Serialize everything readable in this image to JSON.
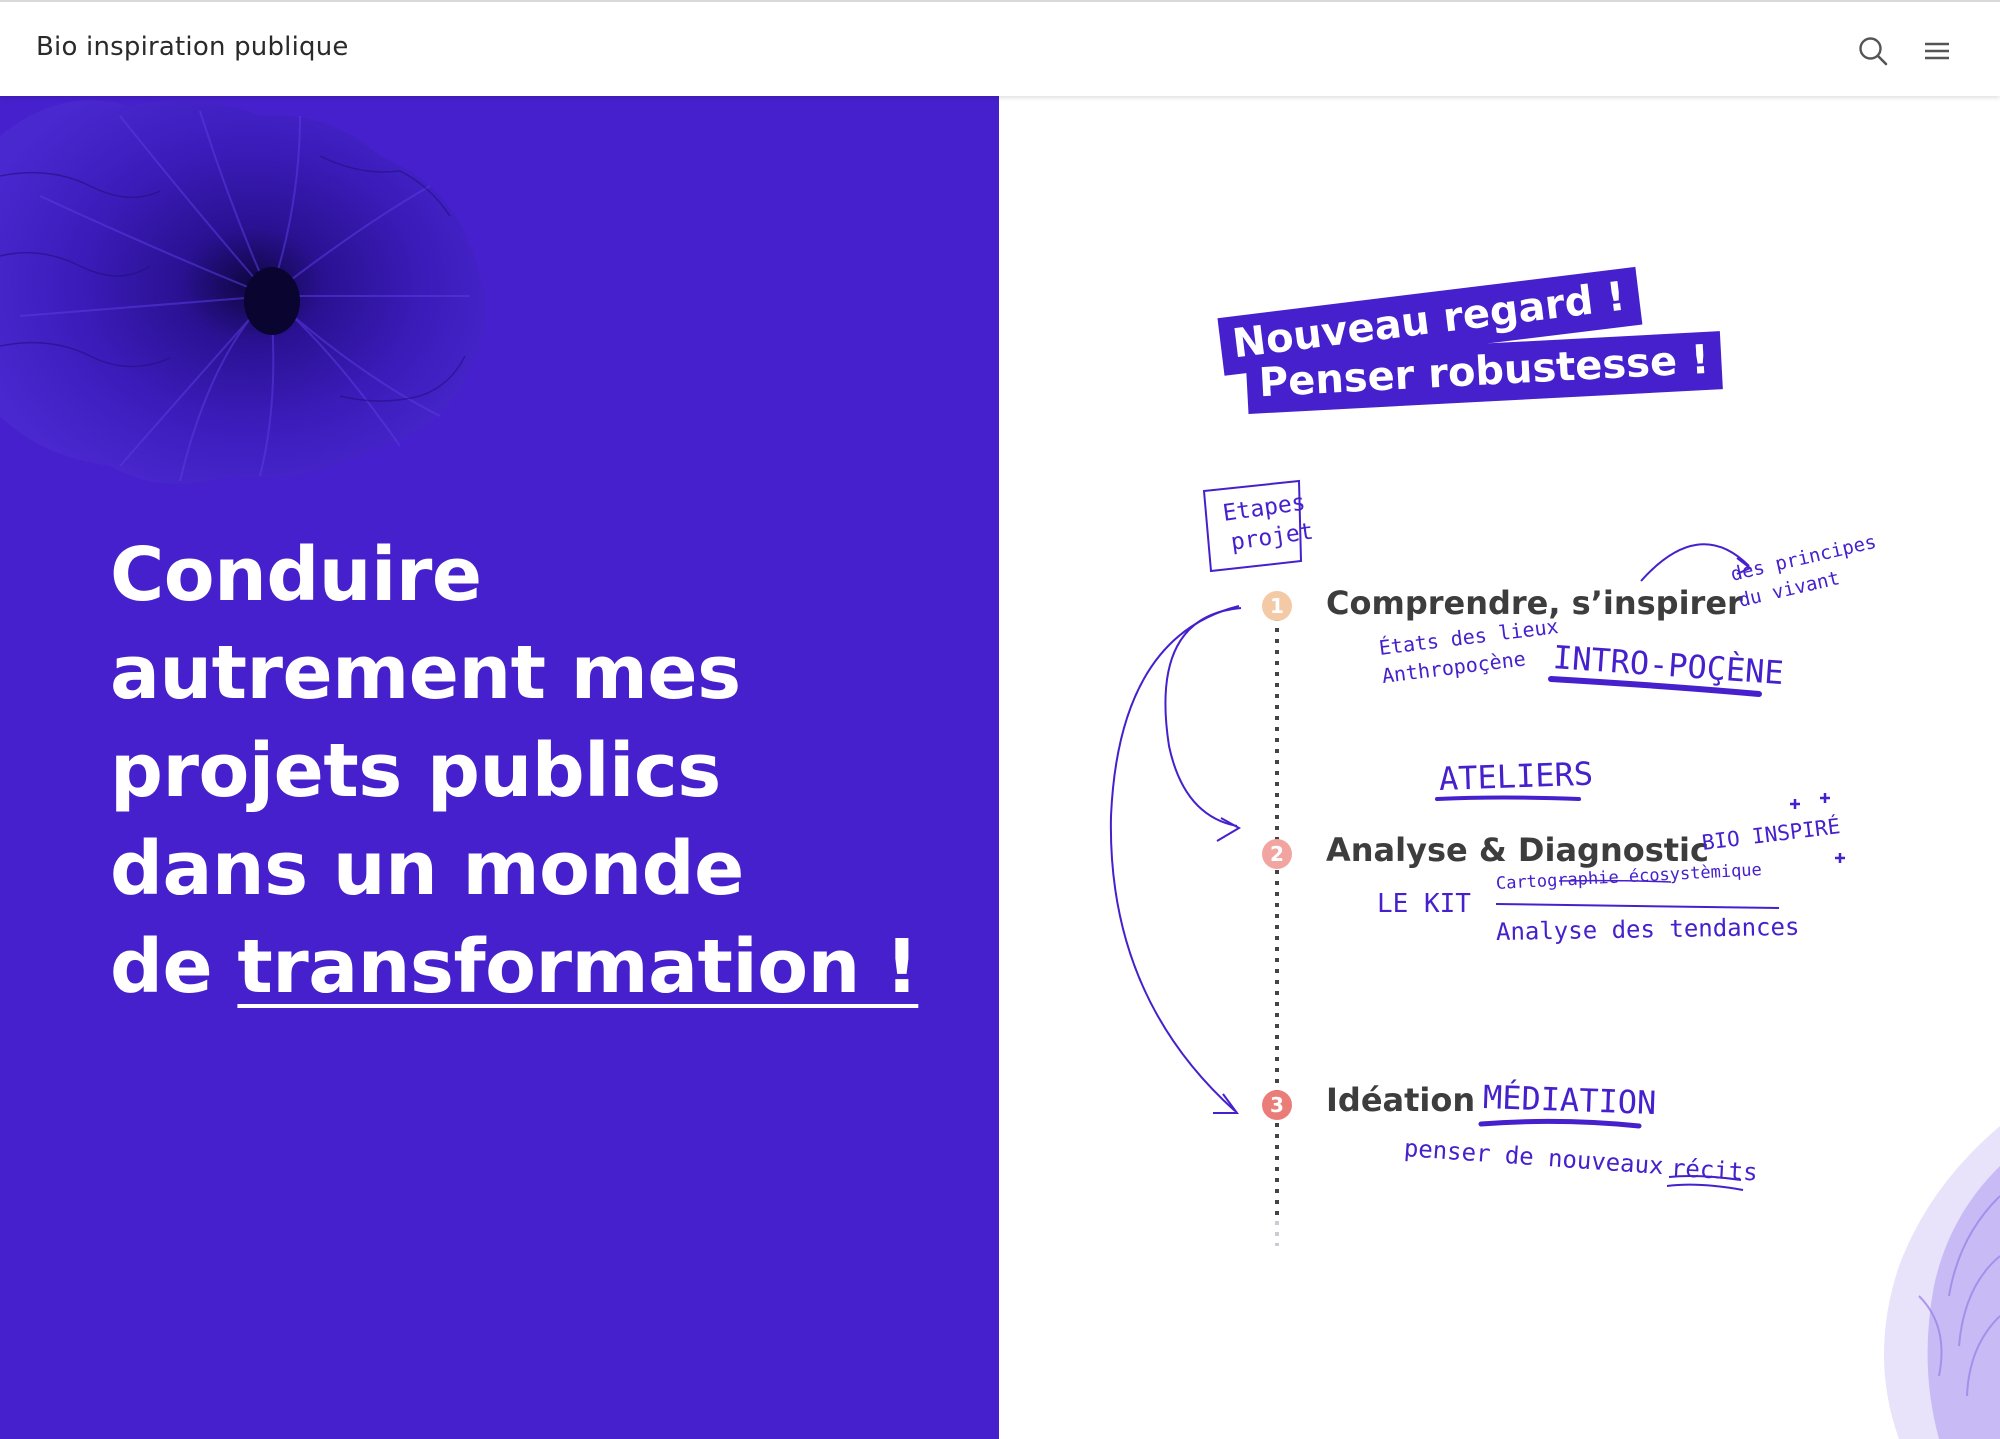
{
  "header": {
    "site_title": "Bio inspiration publique",
    "search_icon": "search-icon",
    "menu_icon": "hamburger-menu-icon"
  },
  "hero": {
    "line1": "Conduire",
    "line2": "autrement mes",
    "line3": "projets publics",
    "line4": "dans un monde",
    "line5_prefix": "de ",
    "line5_highlight": "transformation !"
  },
  "tags": {
    "tag1": "Nouveau regard !",
    "tag2": "Penser robustesse !"
  },
  "diagram": {
    "label_line1": "Etapes",
    "label_line2": "projet",
    "steps": [
      {
        "number": "1",
        "title": "Comprendre, s’inspirer",
        "notes": [
          "des principes",
          "du vivant",
          "États des lieux",
          "Anthropoçène",
          "INTRO-POÇÈNE"
        ]
      },
      {
        "number": "2",
        "title": "Analyse & Diagnostic",
        "notes": [
          "ATELIERS",
          "BIO INSPIRÉ",
          "LE KIT",
          "Cartographie écosystèmique",
          "Analyse des tendances"
        ]
      },
      {
        "number": "3",
        "title": "Idéation",
        "notes": [
          "MÉDIATION",
          "penser de nouveaux",
          "récits"
        ]
      }
    ]
  },
  "colors": {
    "brand_purple": "#4520cc",
    "step1": "#f3c9a6",
    "step2": "#f2a5a0",
    "step3": "#ea7d78"
  }
}
